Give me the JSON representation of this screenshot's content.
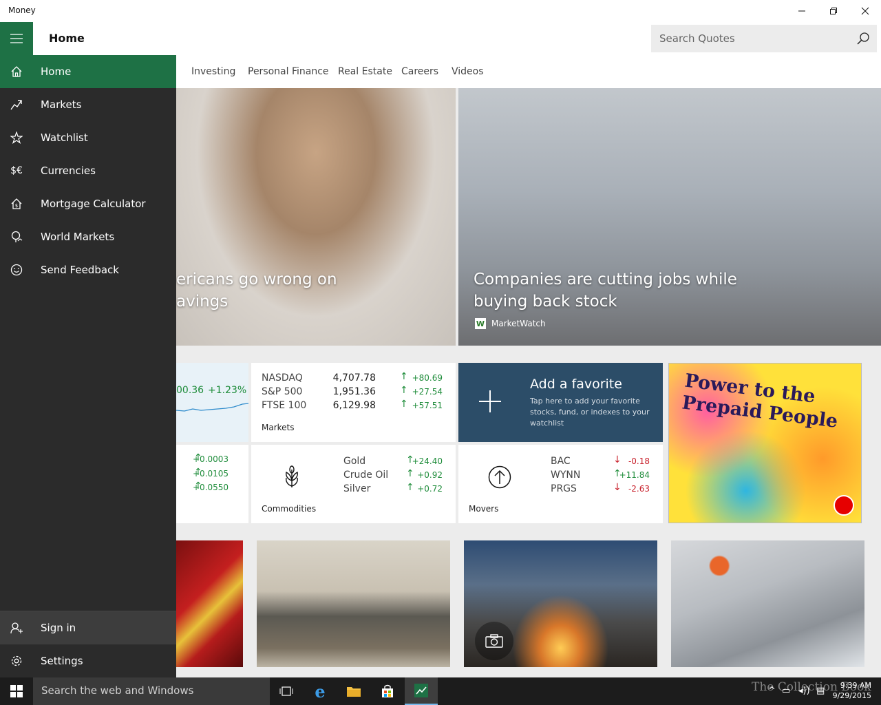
{
  "window": {
    "title": "Money"
  },
  "header": {
    "page_title": "Home",
    "search_placeholder": "Search Quotes"
  },
  "subnav": [
    "Investing",
    "Personal Finance",
    "Real Estate",
    "Careers",
    "Videos"
  ],
  "sidebar": {
    "items": [
      {
        "label": "Home",
        "icon": "home-icon"
      },
      {
        "label": "Markets",
        "icon": "markets-icon"
      },
      {
        "label": "Watchlist",
        "icon": "watchlist-icon"
      },
      {
        "label": "Currencies",
        "icon": "currencies-icon",
        "glyph": "$€"
      },
      {
        "label": "Mortgage Calculator",
        "icon": "mortgage-icon"
      },
      {
        "label": "World Markets",
        "icon": "world-markets-icon"
      },
      {
        "label": "Send Feedback",
        "icon": "feedback-icon"
      }
    ],
    "bottom": [
      {
        "label": "Sign in",
        "icon": "sign-in-icon"
      },
      {
        "label": "Settings",
        "icon": "gear-icon"
      }
    ]
  },
  "hero": [
    {
      "headline": "ericans go wrong on\navings"
    },
    {
      "headline": "Companies are cutting jobs while\nbuying back stock",
      "source": "MarketWatch",
      "source_logo": "W"
    }
  ],
  "partial_index": {
    "value": "00.36",
    "change": "+1.23%"
  },
  "partial_currencies": [
    "+0.0003",
    "+0.0105",
    "+0.0550"
  ],
  "markets": {
    "label": "Markets",
    "rows": [
      {
        "name": "NASDAQ",
        "value": "4,707.78",
        "change": "+80.69",
        "dir": "up"
      },
      {
        "name": "S&P 500",
        "value": "1,951.36",
        "change": "+27.54",
        "dir": "up"
      },
      {
        "name": "FTSE 100",
        "value": "6,129.98",
        "change": "+57.51",
        "dir": "up"
      }
    ]
  },
  "favorite": {
    "title": "Add a favorite",
    "desc": "Tap here to add your favorite stocks, fund, or indexes to your watchlist"
  },
  "commodities": {
    "label": "Commodities",
    "rows": [
      {
        "name": "Gold",
        "change": "+24.40",
        "dir": "up"
      },
      {
        "name": "Crude Oil",
        "change": "+0.92",
        "dir": "up"
      },
      {
        "name": "Silver",
        "change": "+0.72",
        "dir": "up"
      }
    ]
  },
  "movers": {
    "label": "Movers",
    "rows": [
      {
        "name": "BAC",
        "change": "-0.18",
        "dir": "down"
      },
      {
        "name": "WYNN",
        "change": "+11.84",
        "dir": "up"
      },
      {
        "name": "PRGS",
        "change": "-2.63",
        "dir": "down"
      }
    ]
  },
  "ad": {
    "text": "Power to the Prepaid People"
  },
  "taskbar": {
    "search_placeholder": "Search the web and Windows",
    "time": "9:39 AM",
    "date": "9/29/2015",
    "watermark": "The Collection Book"
  },
  "colors": {
    "accent": "#1e7145",
    "sidebar": "#2b2b2b",
    "favorite": "#2c4d68",
    "up": "#1e8c3a",
    "down": "#c8202b"
  }
}
